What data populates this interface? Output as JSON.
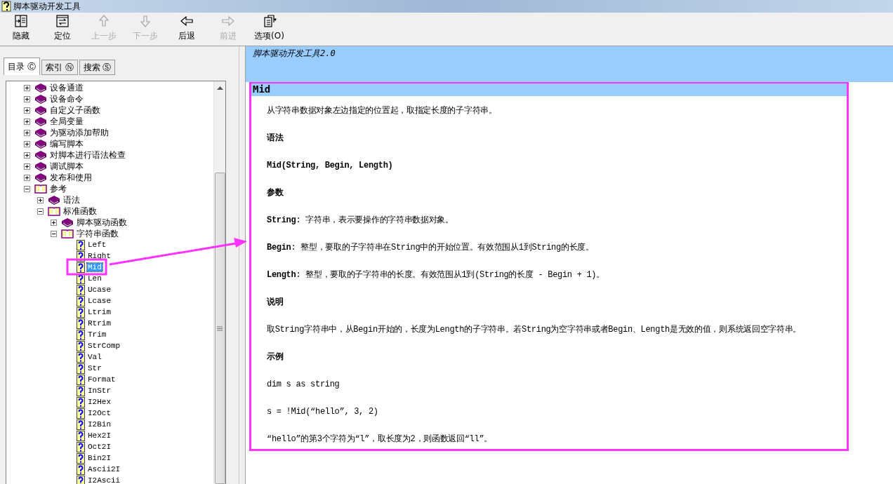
{
  "window": {
    "title": "脚本驱动开发工具"
  },
  "toolbar": [
    {
      "kind": "hide",
      "label": "隐藏",
      "disabled": false
    },
    {
      "kind": "locate",
      "label": "定位",
      "disabled": false
    },
    {
      "kind": "up",
      "label": "上一步",
      "disabled": true
    },
    {
      "kind": "down",
      "label": "下一步",
      "disabled": true
    },
    {
      "kind": "back",
      "label": "后退",
      "disabled": false
    },
    {
      "kind": "forward",
      "label": "前进",
      "disabled": true
    },
    {
      "kind": "options",
      "label": "选项(O)",
      "disabled": false
    }
  ],
  "tabs": [
    {
      "label": "目录 Ⓒ",
      "selected": true
    },
    {
      "label": "索引 Ⓝ",
      "selected": false
    },
    {
      "label": "搜索 Ⓢ",
      "selected": false
    }
  ],
  "tree": [
    {
      "kind": "book",
      "label": "设备通道",
      "expanded": false
    },
    {
      "kind": "book",
      "label": "设备命令",
      "expanded": false
    },
    {
      "kind": "book",
      "label": "自定义子函数",
      "expanded": false
    },
    {
      "kind": "book",
      "label": "全局变量",
      "expanded": false
    },
    {
      "kind": "book",
      "label": "为驱动添加帮助",
      "expanded": false
    },
    {
      "kind": "book",
      "label": "编写脚本",
      "expanded": false
    },
    {
      "kind": "book",
      "label": "对脚本进行语法检查",
      "expanded": false
    },
    {
      "kind": "book",
      "label": "调试脚本",
      "expanded": false
    },
    {
      "kind": "book",
      "label": "发布和使用",
      "expanded": false
    },
    {
      "kind": "book",
      "label": "参考",
      "expanded": true,
      "children": [
        {
          "kind": "book",
          "label": "语法",
          "expanded": false
        },
        {
          "kind": "book",
          "label": "标准函数",
          "expanded": true,
          "children": [
            {
              "kind": "book",
              "label": "脚本驱动函数",
              "expanded": false
            },
            {
              "kind": "book",
              "label": "字符串函数",
              "expanded": true,
              "children": [
                {
                  "kind": "page",
                  "label": "Left",
                  "selected": false
                },
                {
                  "kind": "page",
                  "label": "Right",
                  "selected": false
                },
                {
                  "kind": "page",
                  "label": "Mid",
                  "selected": true
                },
                {
                  "kind": "page",
                  "label": "Len",
                  "selected": false
                },
                {
                  "kind": "page",
                  "label": "Ucase",
                  "selected": false
                },
                {
                  "kind": "page",
                  "label": "Lcase",
                  "selected": false
                },
                {
                  "kind": "page",
                  "label": "Ltrim",
                  "selected": false
                },
                {
                  "kind": "page",
                  "label": "Rtrim",
                  "selected": false
                },
                {
                  "kind": "page",
                  "label": "Trim",
                  "selected": false
                },
                {
                  "kind": "page",
                  "label": "StrComp",
                  "selected": false
                },
                {
                  "kind": "page",
                  "label": "Val",
                  "selected": false
                },
                {
                  "kind": "page",
                  "label": "Str",
                  "selected": false
                },
                {
                  "kind": "page",
                  "label": "Format",
                  "selected": false
                },
                {
                  "kind": "page",
                  "label": "InStr",
                  "selected": false
                },
                {
                  "kind": "page",
                  "label": "I2Hex",
                  "selected": false
                },
                {
                  "kind": "page",
                  "label": "I2Oct",
                  "selected": false
                },
                {
                  "kind": "page",
                  "label": "I2Bin",
                  "selected": false
                },
                {
                  "kind": "page",
                  "label": "Hex2I",
                  "selected": false
                },
                {
                  "kind": "page",
                  "label": "Oct2I",
                  "selected": false
                },
                {
                  "kind": "page",
                  "label": "Bin2I",
                  "selected": false
                },
                {
                  "kind": "page",
                  "label": "Ascii2I",
                  "selected": false
                },
                {
                  "kind": "page",
                  "label": "I2Ascii",
                  "selected": false
                }
              ]
            }
          ]
        }
      ]
    }
  ],
  "content": {
    "banner": "脚本驱动开发工具2.0",
    "topic": "Mid",
    "paragraphs": [
      {
        "kind": "text",
        "text": "从字符串数据对象左边指定的位置起，取指定长度的子字符串。"
      },
      {
        "kind": "heading",
        "text": "语法"
      },
      {
        "kind": "syntax",
        "text": "Mid(String, Begin, Length)"
      },
      {
        "kind": "heading",
        "text": "参数"
      },
      {
        "kind": "text",
        "text": "**String**: 字符串，表示要操作的字符串数据对象。"
      },
      {
        "kind": "text",
        "text": "**Begin**: 整型，要取的子字符串在String中的开始位置。有效范围从1到String的长度。"
      },
      {
        "kind": "text",
        "text": "**Length**: 整型，要取的子字符串的长度。有效范围从1到(String的长度 - Begin + 1)。"
      },
      {
        "kind": "heading",
        "text": "说明"
      },
      {
        "kind": "text",
        "text": "取String字符串中，从Begin开始的，长度为Length的子字符串。若String为空字符串或者Begin、Length是无效的值，则系统返回空字符串。"
      },
      {
        "kind": "heading",
        "text": "示例"
      },
      {
        "kind": "text",
        "text": "dim s as string"
      },
      {
        "kind": "text",
        "text": "s = !Mid(“hello”, 3, 2)"
      },
      {
        "kind": "text",
        "text": "“hello”的第3个字符为“l”，取长度为2，则函数返回“ll”。"
      }
    ]
  }
}
